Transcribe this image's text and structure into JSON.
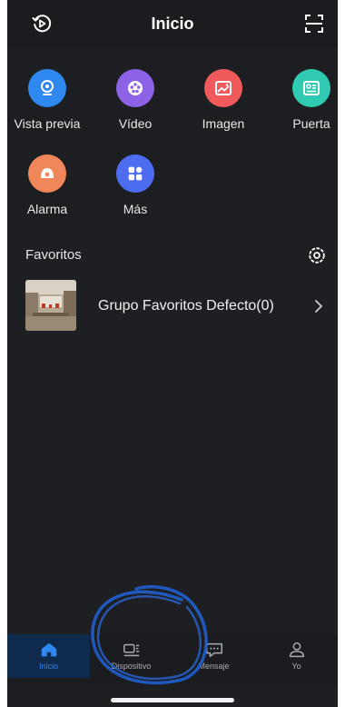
{
  "header": {
    "title": "Inicio",
    "left_icon": "playback-icon",
    "right_icon": "scan-icon"
  },
  "apps": [
    {
      "label": "Vista previa",
      "icon": "camera-icon",
      "color": "#2f87f0"
    },
    {
      "label": "Vídeo",
      "icon": "film-reel-icon",
      "color": "#8e62e6"
    },
    {
      "label": "Imagen",
      "icon": "image-icon",
      "color": "#f05a5a"
    },
    {
      "label": "Puerta",
      "icon": "door-intercom-icon",
      "color": "#2fcab1"
    },
    {
      "label": "Alarma",
      "icon": "alarm-icon",
      "color": "#f0875a"
    },
    {
      "label": "Más",
      "icon": "more-grid-icon",
      "color": "#4d6cf0"
    }
  ],
  "favorites": {
    "title": "Favoritos",
    "settings_icon": "gear-icon",
    "items": [
      {
        "name": "Grupo Favoritos Defecto(0)",
        "icon": "chevron-right-icon"
      }
    ]
  },
  "tabbar": {
    "tabs": [
      {
        "label": "Inicio",
        "icon": "home-icon",
        "active": true
      },
      {
        "label": "Dispositivo",
        "icon": "device-icon",
        "active": false
      },
      {
        "label": "Mensaje",
        "icon": "message-icon",
        "active": false
      },
      {
        "label": "Yo",
        "icon": "user-icon",
        "active": false
      }
    ]
  },
  "colors": {
    "active_tab": "#2f87f0",
    "inactive_tab": "#a9abb0",
    "annotation": "#1f5fd0"
  }
}
